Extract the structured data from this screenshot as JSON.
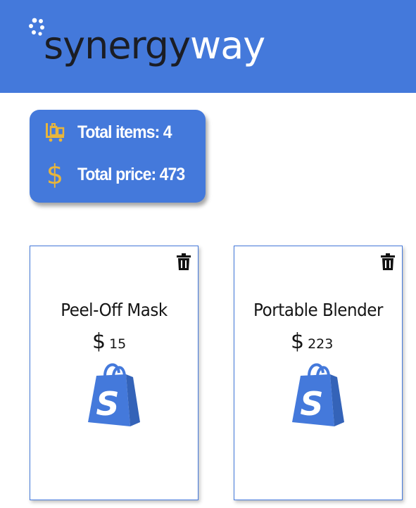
{
  "header": {
    "logo_part1": "synergy",
    "logo_part2": "way",
    "brand_color": "#4479db"
  },
  "summary": {
    "items_label": "Total items: 4",
    "price_label": "Total price: 473",
    "items_icon": "luggage-cart-icon",
    "price_icon": "dollar-icon",
    "icon_color": "#e8b53b"
  },
  "products": [
    {
      "name": "Peel-Off Mask",
      "currency": "$",
      "price": "15",
      "image": "shopify-bag-icon",
      "action": "trash-icon"
    },
    {
      "name": "Portable Blender",
      "currency": "$",
      "price": "223",
      "image": "shopify-bag-icon",
      "action": "trash-icon"
    }
  ]
}
